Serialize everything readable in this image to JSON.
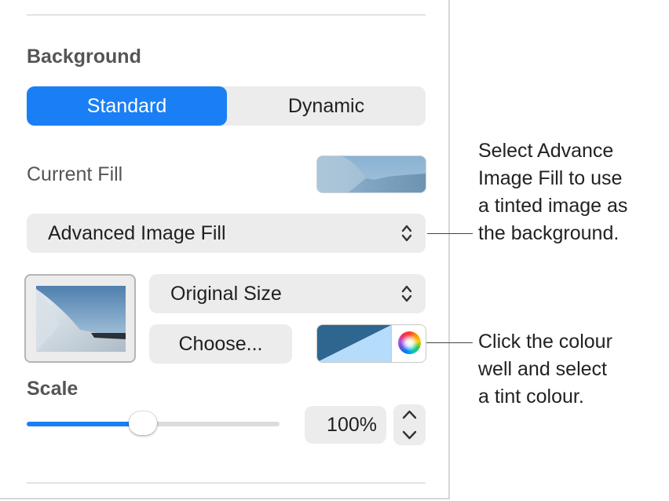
{
  "sidebar": {
    "background_heading": "Background",
    "segmented": {
      "standard": "Standard",
      "dynamic": "Dynamic",
      "selected": "Standard"
    },
    "current_fill_label": "Current Fill",
    "fill_type": "Advanced Image Fill",
    "scale_mode": "Original Size",
    "choose_button": "Choose...",
    "tint_color": "#2e6690",
    "scale_heading": "Scale",
    "scale_value": "100%",
    "scale_fraction": 0.46
  },
  "annotations": {
    "fill_callout": [
      "Select Advance",
      "Image Fill to use",
      "a tinted image as",
      "the background."
    ],
    "color_callout": [
      "Click the colour",
      "well and select",
      "a tint colour."
    ]
  },
  "colors": {
    "accent": "#1a7ff5",
    "control_bg": "#ececec"
  },
  "icons": [
    "up-down-chevron-icon",
    "color-wheel-icon",
    "stepper-up-icon",
    "stepper-down-icon"
  ]
}
